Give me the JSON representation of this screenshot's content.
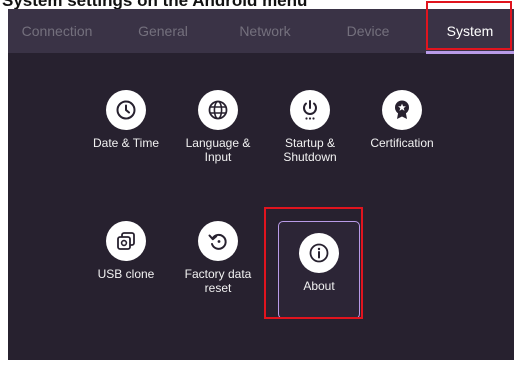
{
  "caption": "System settings on the Android menu",
  "tabs": [
    {
      "label": "Connection"
    },
    {
      "label": "General"
    },
    {
      "label": "Network"
    },
    {
      "label": "Device"
    },
    {
      "label": "System"
    }
  ],
  "active_tab": "System",
  "tiles": [
    {
      "label": "Date & Time",
      "icon": "clock-icon"
    },
    {
      "label": "Language &\nInput",
      "icon": "globe-icon"
    },
    {
      "label": "Startup &\nShutdown",
      "icon": "power-icon"
    },
    {
      "label": "Certification",
      "icon": "ribbon-badge-icon"
    },
    {
      "label": "USB clone",
      "icon": "copy-settings-icon"
    },
    {
      "label": "Factory data\nreset",
      "icon": "reset-icon"
    },
    {
      "label": "About",
      "icon": "info-icon"
    }
  ],
  "colors": {
    "accent": "#b99be8",
    "highlight": "#e0141e",
    "background": "#27212f",
    "tabbar": "#3a3346"
  }
}
